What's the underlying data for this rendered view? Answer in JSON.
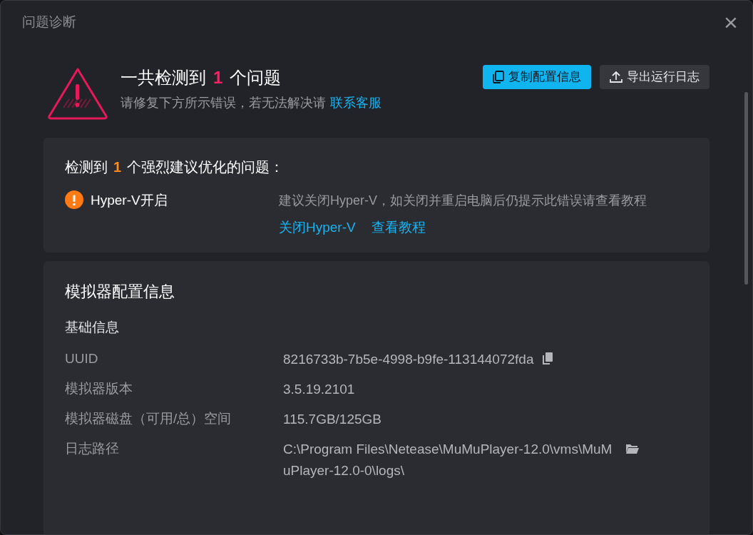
{
  "window": {
    "title": "问题诊断",
    "close": "×"
  },
  "summary": {
    "prefix": "一共检测到",
    "count": "1",
    "suffix": "个问题",
    "subtitle": "请修复下方所示错误，若无法解决请",
    "contact_link": "联系客服"
  },
  "buttons": [
    {
      "label": "复制配置信息",
      "kind": "primary"
    },
    {
      "label": "导出运行日志",
      "kind": "secondary"
    }
  ],
  "issues_card": {
    "prefix": "检测到",
    "count": "1",
    "suffix": "个强烈建议优化的问题：",
    "issues": [
      {
        "name": "Hyper-V开启",
        "description": "建议关闭Hyper-V，如关闭并重启电脑后仍提示此错误请查看教程",
        "links": [
          "关闭Hyper-V",
          "查看教程"
        ]
      }
    ]
  },
  "config_card": {
    "title": "模拟器配置信息",
    "section": "基础信息",
    "rows": [
      {
        "label": "UUID",
        "value": "8216733b-7b5e-4998-b9fe-113144072fda",
        "kind": "copy"
      },
      {
        "label": "模拟器版本",
        "value": "3.5.19.2101",
        "kind": "plain"
      },
      {
        "label": "模拟器磁盘（可用/总）空间",
        "value": "115.7GB/125GB",
        "kind": "plain"
      },
      {
        "label": "日志路径",
        "value": "C:\\Program Files\\Netease\\MuMuPlayer-12.0\\vms\\MuMuPlayer-12.0-0\\logs\\",
        "kind": "folder"
      }
    ]
  }
}
